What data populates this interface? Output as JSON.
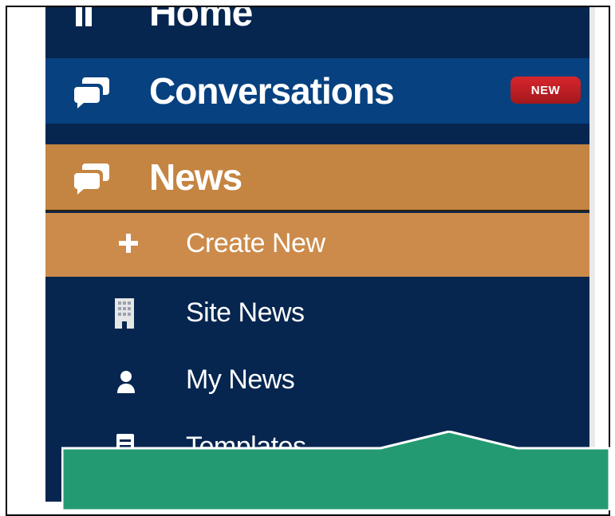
{
  "nav": {
    "home": {
      "label": "Home",
      "icon": "home-icon"
    },
    "conversations": {
      "label": "Conversations",
      "icon": "chat-bubbles-icon",
      "badge": "NEW"
    },
    "news": {
      "label": "News",
      "icon": "chat-bubbles-icon"
    },
    "submenu": [
      {
        "label": "Create New",
        "icon": "plus-icon"
      },
      {
        "label": "Site News",
        "icon": "building-icon"
      },
      {
        "label": "My News",
        "icon": "user-icon"
      },
      {
        "label": "Templates",
        "icon": "document-icon"
      }
    ]
  },
  "colors": {
    "sidebar_bg": "#062650",
    "active_bg": "#07417f",
    "news_bg": "#c48542",
    "create_bg": "#cc8b4b",
    "badge_bg": "#c81f25",
    "tooltip_bg": "#249a73"
  }
}
